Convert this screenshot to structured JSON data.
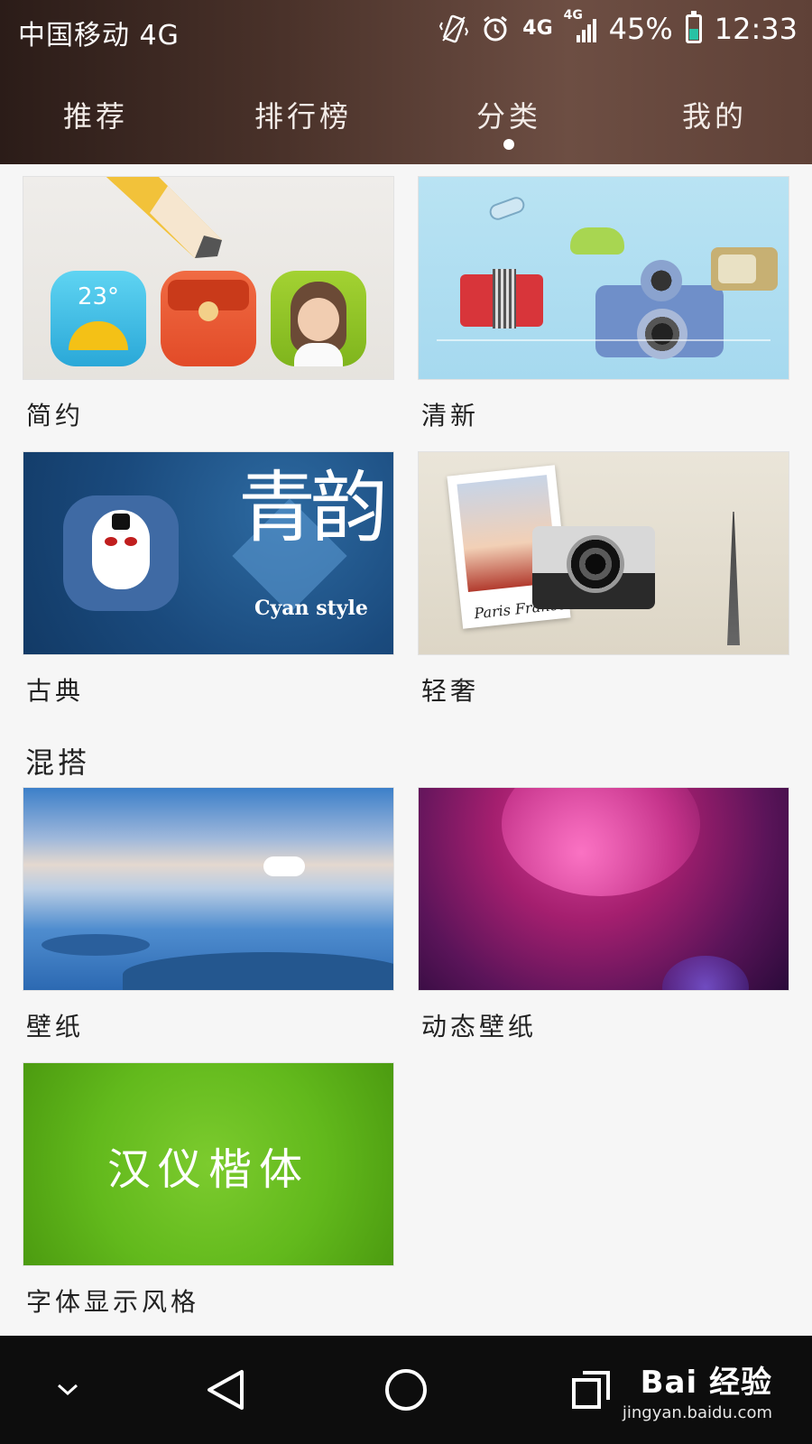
{
  "status_bar": {
    "carrier": "中国移动 4G",
    "net_primary": "4G",
    "net_secondary": "4G",
    "battery_percent": "45%",
    "battery_level": 0.45,
    "time": "12:33",
    "icons": [
      "vibrate-icon",
      "alarm-icon",
      "signal-icon",
      "battery-icon"
    ]
  },
  "tabs": [
    {
      "label": "推荐",
      "active": false
    },
    {
      "label": "排行榜",
      "active": false
    },
    {
      "label": "分类",
      "active": true
    },
    {
      "label": "我的",
      "active": false
    }
  ],
  "categories": [
    {
      "label": "简约",
      "weather_temp": "23°"
    },
    {
      "label": "清新"
    },
    {
      "label": "古典",
      "art_title": "青韵",
      "art_subtitle": "Cyan style"
    },
    {
      "label": "轻奢",
      "photo_caption": "Paris France"
    }
  ],
  "mix_section": {
    "title": "混搭",
    "items": [
      {
        "label": "壁纸"
      },
      {
        "label": "动态壁纸"
      },
      {
        "label": "字体显示风格",
        "art_text": "汉仪楷体"
      }
    ]
  },
  "navbar": {
    "buttons": [
      "chevron-down-icon",
      "back-icon",
      "home-icon",
      "recents-icon"
    ],
    "watermark_logo": "Bai 经验",
    "watermark_url": "jingyan.baidu.com"
  },
  "colors": {
    "header_dark": "#2b1c18",
    "header_light": "#6d4e43",
    "battery_fill": "#27c2a4",
    "page_bg": "#f6f6f6"
  }
}
